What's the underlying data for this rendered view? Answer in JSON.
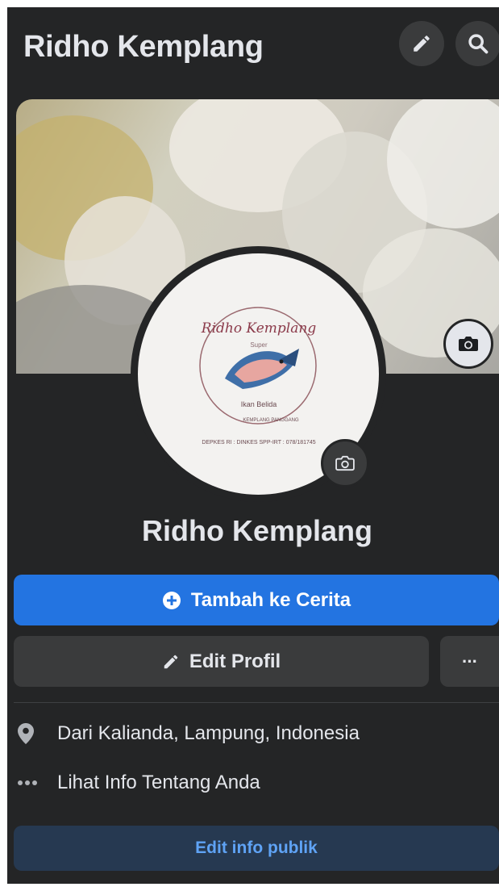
{
  "header": {
    "title": "Ridho Kemplang",
    "edit_icon": "pencil-icon",
    "search_icon": "search-icon"
  },
  "avatar": {
    "logo_script": "Ridho Kemplang",
    "logo_small": "Super",
    "logo_fish_label": "Ikan Belida",
    "logo_arc_text": "KEMPLANG PANGGANG",
    "logo_footer": "DEPKES RI : DINKES SPP-IRT : 078/181745"
  },
  "profile": {
    "name": "Ridho Kemplang"
  },
  "actions": {
    "add_story_label": "Tambah ke Cerita",
    "edit_profile_label": "Edit Profil",
    "more_label": "···"
  },
  "info": {
    "location": "Dari Kalianda, Lampung, Indonesia",
    "about": "Lihat Info Tentang Anda",
    "edit_public": "Edit info publik"
  },
  "colors": {
    "background": "#242526",
    "primary": "#2374e1",
    "secondary": "#3a3b3c",
    "text": "#e4e6eb",
    "link": "#5fa3f5"
  }
}
